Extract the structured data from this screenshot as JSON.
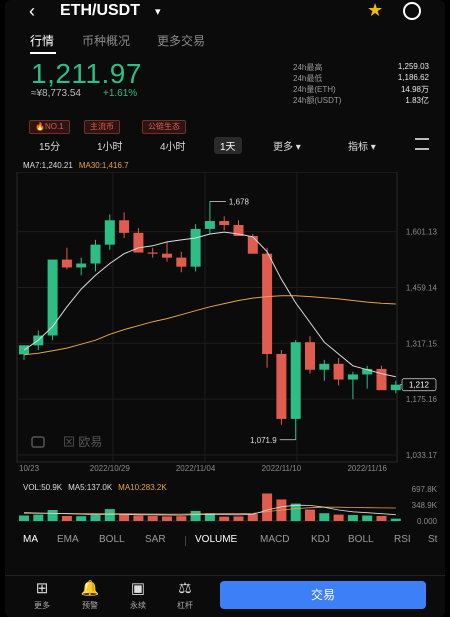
{
  "header": {
    "back_icon": "chevron-left-icon",
    "pair": "ETH/USDT",
    "caret": "▾",
    "favorite_icon": "star-icon",
    "share_icon": "share-icon",
    "star_color": "#f0b90b"
  },
  "tabs": [
    {
      "label": "行情",
      "active": true
    },
    {
      "label": "币种概况",
      "active": false
    },
    {
      "label": "更多交易",
      "active": false
    }
  ],
  "ticker": {
    "price": "1,211.97",
    "fiat": "≈¥8,773.54",
    "change": "+1.61%",
    "up_color": "#2ebd85",
    "down_color": "#e05c4f"
  },
  "stats": [
    {
      "label": "24h最高",
      "value": "1,259.03"
    },
    {
      "label": "24h最低",
      "value": "1,186.62"
    },
    {
      "label": "24h量(ETH)",
      "value": "14.98万"
    },
    {
      "label": "24h额(USDT)",
      "value": "1.83亿"
    }
  ],
  "tags": [
    "🔥NO.1",
    "主流币",
    "公链生态"
  ],
  "timeframes": {
    "items": [
      "15分",
      "1小时",
      "4小时",
      "1天"
    ],
    "active": "1天",
    "more": "更多 ▾",
    "indicators": "指标 ▾",
    "settings_icon": "settings-sliders-icon"
  },
  "ma_legend": {
    "ma7": "MA7:1,240.21",
    "ma30": "MA30:1,416.7"
  },
  "chart_data": {
    "type": "candlestick",
    "y_axis_labels": [
      "1,601.13",
      "1,459.14",
      "1,317.15",
      "1,175.16",
      "1,033.17"
    ],
    "y_axis_values": [
      1601.13,
      1459.14,
      1317.15,
      1175.16,
      1033.17
    ],
    "ylim": [
      1033.17,
      1740
    ],
    "x_labels": [
      "10/23",
      "2022/10/29",
      "2022/11/04",
      "2022/11/10",
      "2022/11/16"
    ],
    "x_label_indices": [
      0,
      6,
      12,
      18,
      24
    ],
    "current_price_label": "1,212",
    "current_price": 1212,
    "annotations": [
      {
        "text": "1,678",
        "index": 13,
        "value": 1678
      },
      {
        "text": "1,071.9",
        "index": 19,
        "value": 1071.9
      }
    ],
    "candles": [
      {
        "o": 1289,
        "h": 1300,
        "l": 1275,
        "c": 1312
      },
      {
        "o": 1312,
        "h": 1350,
        "l": 1300,
        "c": 1337
      },
      {
        "o": 1337,
        "h": 1400,
        "l": 1325,
        "c": 1530
      },
      {
        "o": 1530,
        "h": 1560,
        "l": 1505,
        "c": 1510
      },
      {
        "o": 1510,
        "h": 1535,
        "l": 1490,
        "c": 1520
      },
      {
        "o": 1520,
        "h": 1580,
        "l": 1500,
        "c": 1568
      },
      {
        "o": 1568,
        "h": 1645,
        "l": 1555,
        "c": 1630
      },
      {
        "o": 1630,
        "h": 1650,
        "l": 1585,
        "c": 1598
      },
      {
        "o": 1598,
        "h": 1610,
        "l": 1550,
        "c": 1548
      },
      {
        "o": 1548,
        "h": 1560,
        "l": 1535,
        "c": 1545
      },
      {
        "o": 1545,
        "h": 1575,
        "l": 1525,
        "c": 1535
      },
      {
        "o": 1535,
        "h": 1550,
        "l": 1498,
        "c": 1512
      },
      {
        "o": 1512,
        "h": 1620,
        "l": 1500,
        "c": 1608
      },
      {
        "o": 1608,
        "h": 1678,
        "l": 1595,
        "c": 1628
      },
      {
        "o": 1628,
        "h": 1640,
        "l": 1605,
        "c": 1618
      },
      {
        "o": 1618,
        "h": 1630,
        "l": 1590,
        "c": 1590
      },
      {
        "o": 1590,
        "h": 1595,
        "l": 1545,
        "c": 1545
      },
      {
        "o": 1545,
        "h": 1560,
        "l": 1255,
        "c": 1290
      },
      {
        "o": 1290,
        "h": 1300,
        "l": 1110,
        "c": 1125
      },
      {
        "o": 1125,
        "h": 1325,
        "l": 1072,
        "c": 1320
      },
      {
        "o": 1320,
        "h": 1335,
        "l": 1240,
        "c": 1250
      },
      {
        "o": 1250,
        "h": 1275,
        "l": 1222,
        "c": 1265
      },
      {
        "o": 1265,
        "h": 1280,
        "l": 1210,
        "c": 1225
      },
      {
        "o": 1225,
        "h": 1245,
        "l": 1175,
        "c": 1238
      },
      {
        "o": 1238,
        "h": 1260,
        "l": 1202,
        "c": 1252
      },
      {
        "o": 1252,
        "h": 1260,
        "l": 1200,
        "c": 1198
      },
      {
        "o": 1198,
        "h": 1222,
        "l": 1190,
        "c": 1212
      }
    ],
    "ma7": [
      1300,
      1325,
      1360,
      1410,
      1455,
      1490,
      1520,
      1545,
      1560,
      1565,
      1575,
      1580,
      1585,
      1595,
      1600,
      1595,
      1588,
      1550,
      1480,
      1420,
      1370,
      1320,
      1290,
      1260,
      1250,
      1240,
      1232
    ],
    "ma30": [
      1288,
      1292,
      1298,
      1305,
      1315,
      1325,
      1340,
      1352,
      1362,
      1372,
      1380,
      1390,
      1400,
      1410,
      1418,
      1426,
      1432,
      1436,
      1438,
      1438,
      1436,
      1433,
      1430,
      1426,
      1422,
      1419,
      1417
    ],
    "up_color": "#2ebd85",
    "down_color": "#e05c4f",
    "ma7_color": "#dddddd",
    "ma30_color": "#e8a24a",
    "watermark": "欧易",
    "watermark_icon": "okx-logo-icon"
  },
  "volume_data": {
    "legend": {
      "vol": "VOL:50.9K",
      "ma5": "MA5:137.0K",
      "ma10": "MA10:283.2K"
    },
    "y_labels": [
      "697.8K",
      "348.9K",
      "0.000"
    ],
    "ylim": [
      0,
      697.8
    ],
    "values": [
      120,
      140,
      240,
      110,
      105,
      130,
      260,
      140,
      120,
      110,
      100,
      105,
      220,
      170,
      95,
      100,
      150,
      600,
      470,
      380,
      250,
      170,
      140,
      130,
      120,
      110,
      51
    ],
    "ma5": [
      180,
      175,
      165,
      160,
      150,
      140,
      150,
      145,
      138,
      135,
      130,
      128,
      140,
      145,
      140,
      135,
      145,
      240,
      310,
      345,
      340,
      300,
      240,
      200,
      180,
      160,
      137
    ],
    "ma10": [
      170,
      168,
      166,
      164,
      162,
      160,
      158,
      156,
      154,
      152,
      150,
      150,
      155,
      158,
      160,
      160,
      165,
      205,
      240,
      270,
      290,
      300,
      300,
      295,
      290,
      286,
      283
    ]
  },
  "indicator_tabs": {
    "main": [
      "MA",
      "EMA",
      "BOLL",
      "SAR"
    ],
    "sub": [
      "VOLUME",
      "MACD",
      "KDJ",
      "BOLL",
      "RSI",
      "St"
    ],
    "active_main": "MA",
    "active_sub": "VOLUME"
  },
  "bottom_nav": [
    {
      "label": "更多",
      "icon": "grid-icon",
      "glyph": "⊞"
    },
    {
      "label": "预警",
      "icon": "bell-icon",
      "glyph": "🔔"
    },
    {
      "label": "永续",
      "icon": "contract-icon",
      "glyph": "▣"
    },
    {
      "label": "杠杆",
      "icon": "leverage-icon",
      "glyph": "⚖"
    }
  ],
  "trade_button": "交易"
}
